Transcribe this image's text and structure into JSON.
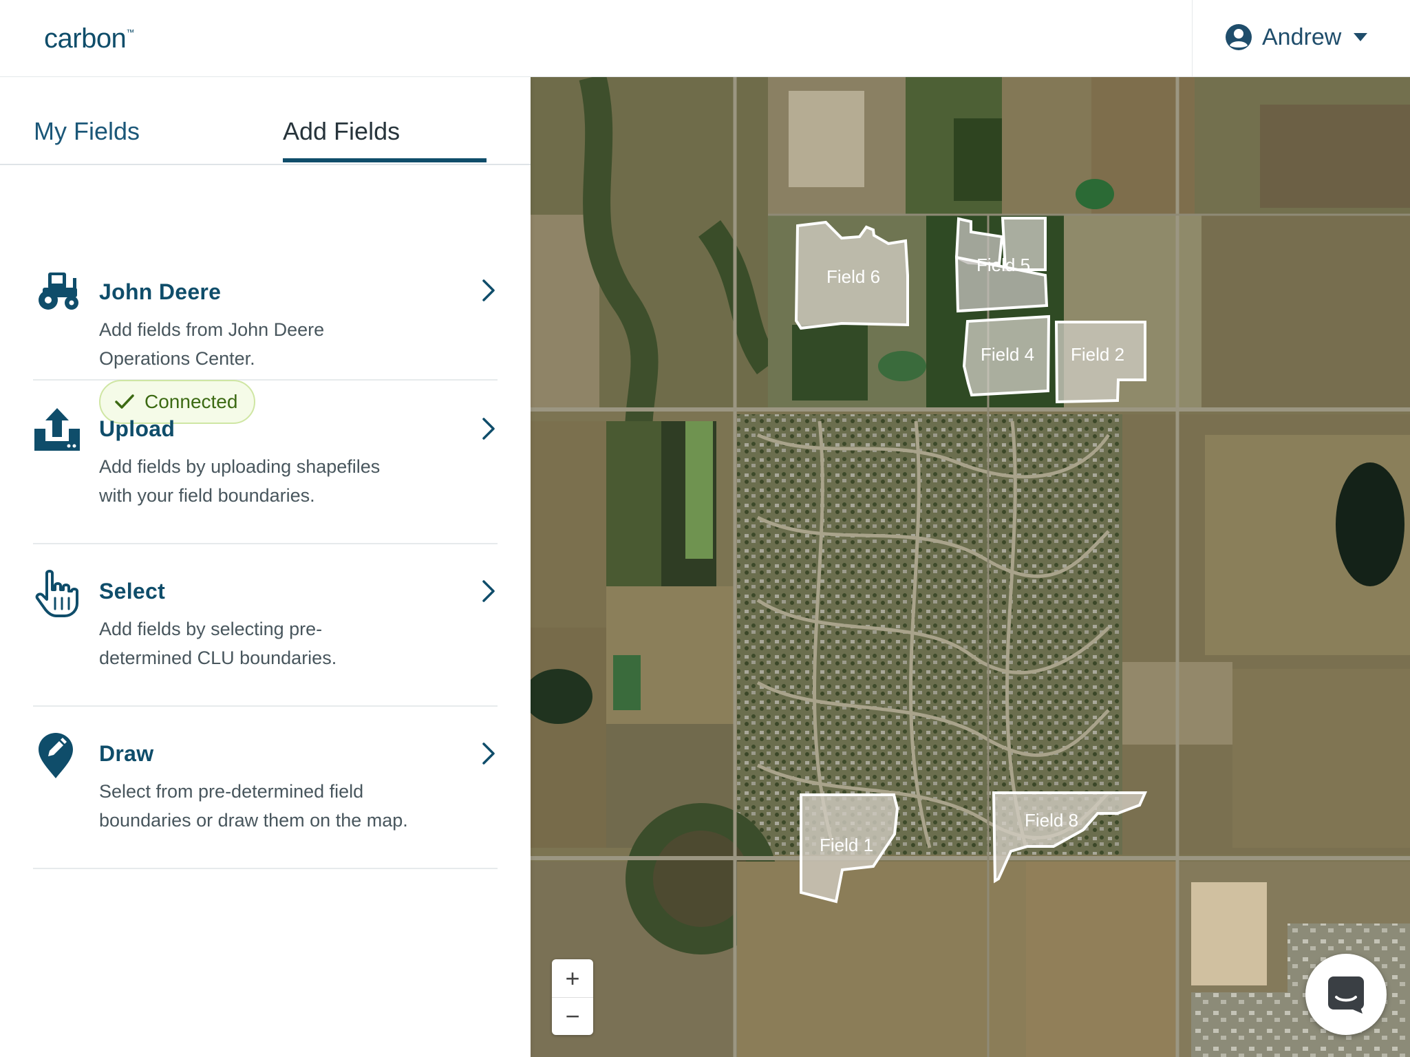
{
  "app": {
    "logo": "carbon",
    "user_name": "Andrew"
  },
  "tabs": [
    {
      "label": "My Fields",
      "active": false
    },
    {
      "label": "Add Fields",
      "active": true
    }
  ],
  "options": [
    {
      "title": "John Deere",
      "desc_line1": "Add fields from John Deere",
      "desc_line2": "Operations Center.",
      "badge": "Connected",
      "icon": "tractor-icon"
    },
    {
      "title": "Upload",
      "desc_line1": "Add fields by uploading shapefiles",
      "desc_line2": "with your field boundaries.",
      "icon": "upload-icon"
    },
    {
      "title": "Select",
      "desc_line1": "Add fields by selecting pre-",
      "desc_line2": "determined CLU boundaries.",
      "icon": "pointer-hand-icon"
    },
    {
      "title": "Draw",
      "desc_line1": "Select from pre-determined field",
      "desc_line2": "boundaries or draw them on the map.",
      "icon": "pencil-pin-icon"
    }
  ],
  "map": {
    "fields": [
      {
        "label": "Field 6"
      },
      {
        "label": "Field 5"
      },
      {
        "label": "Field 4"
      },
      {
        "label": "Field 2"
      },
      {
        "label": "Field 1"
      },
      {
        "label": "Field 8"
      }
    ],
    "zoom_in": "+",
    "zoom_out": "−"
  },
  "colors": {
    "brand": "#0f4d6a",
    "connected_text": "#3c6a13",
    "connected_bg": "#f5fbe8"
  }
}
